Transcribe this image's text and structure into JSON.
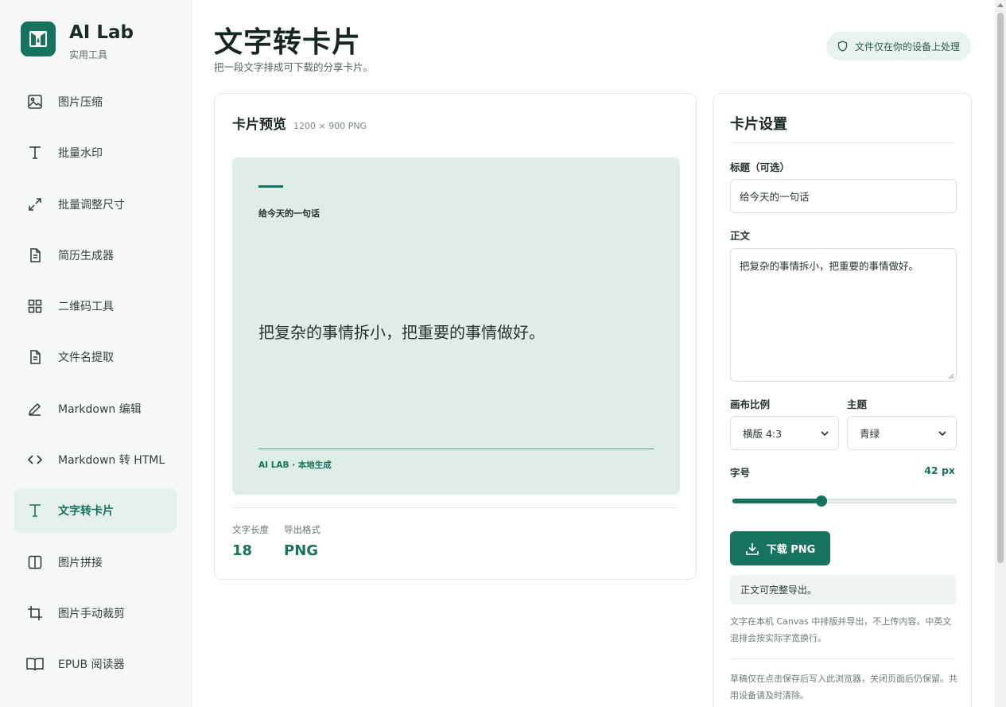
{
  "brand": {
    "name": "AI Lab",
    "subtitle": "实用工具"
  },
  "sidebar": {
    "items": [
      {
        "label": "图片压缩",
        "icon": "image-icon"
      },
      {
        "label": "批量水印",
        "icon": "text-icon"
      },
      {
        "label": "批量调整尺寸",
        "icon": "expand-icon"
      },
      {
        "label": "简历生成器",
        "icon": "document-icon"
      },
      {
        "label": "二维码工具",
        "icon": "grid-icon"
      },
      {
        "label": "文件名提取",
        "icon": "document-icon"
      },
      {
        "label": "Markdown 编辑",
        "icon": "pen-icon"
      },
      {
        "label": "Markdown 转 HTML",
        "icon": "code-icon"
      },
      {
        "label": "文字转卡片",
        "icon": "text-icon",
        "active": true
      },
      {
        "label": "图片拼接",
        "icon": "columns-icon"
      },
      {
        "label": "图片手动裁剪",
        "icon": "crop-icon"
      },
      {
        "label": "EPUB 阅读器",
        "icon": "book-icon"
      }
    ]
  },
  "header": {
    "title": "文字转卡片",
    "subtitle": "把一段文字排成可下载的分享卡片。",
    "privacy_badge": "文件仅在你的设备上处理"
  },
  "preview": {
    "title": "卡片预览",
    "size_label": "1200 × 900 PNG",
    "card": {
      "title": "给今天的一句话",
      "body": "把复杂的事情拆小，把重要的事情做好。",
      "footer": "AI LAB · 本地生成",
      "background": "#ddeee6",
      "accent": "#17725e"
    },
    "stats": [
      {
        "label": "文字长度",
        "value": "18"
      },
      {
        "label": "导出格式",
        "value": "PNG"
      }
    ]
  },
  "settings": {
    "title": "卡片设置",
    "title_field_label": "标题（可选）",
    "title_field_value": "给今天的一句话",
    "body_field_label": "正文",
    "body_field_value": "把复杂的事情拆小，把重要的事情做好。",
    "ratio_label": "画布比例",
    "ratio_value": "横版 4:3",
    "theme_label": "主题",
    "theme_value": "青绿",
    "font_size_label": "字号",
    "font_size_value": "42 px",
    "font_size_fraction": 0.4,
    "download_label": "下载 PNG",
    "status": "正文可完整导出。",
    "note1": "文字在本机 Canvas 中排版并导出，不上传内容。中英文混排会按实际字宽换行。",
    "note2": "草稿仅在点击保存后写入此浏览器，关闭页面后仍保留。共用设备请及时清除。"
  },
  "colors": {
    "accent": "#17725e",
    "active_bg": "#e3f0eb"
  }
}
